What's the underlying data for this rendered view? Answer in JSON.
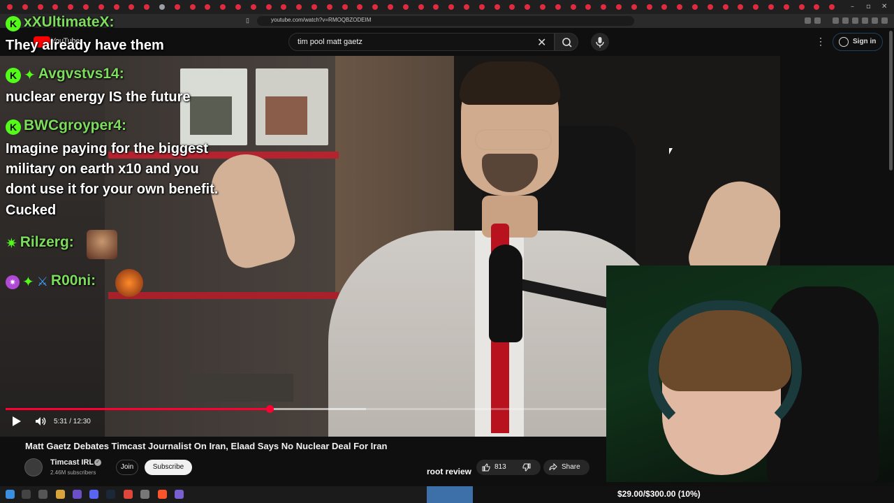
{
  "browser": {
    "url": "youtube.com/watch?v=RMOQBZODEIM"
  },
  "search": {
    "query": "tim pool matt gaetz"
  },
  "header": {
    "logo_text": "YouTube",
    "sign_in_label": "Sign in"
  },
  "player": {
    "time": "5:31 / 12:30",
    "progress_fraction": 0.44,
    "buffered_fraction": 0.6
  },
  "chat": {
    "messages": [
      {
        "user": "xXUltimateX:",
        "text": "They already have them"
      },
      {
        "user": "Avgvstvs14:",
        "text": "nuclear energy IS the future"
      },
      {
        "user": "BWCgroyper4:",
        "text_lines": [
          "Imagine paying for the biggest",
          "military on earth x10 and you",
          "dont use it for your own benefit.",
          "Cucked"
        ]
      },
      {
        "user": "Rilzerg:",
        "text": ""
      },
      {
        "user": "R00ni:",
        "text": ""
      }
    ]
  },
  "video": {
    "title": "Matt Gaetz Debates Timcast Journalist On Iran, Elaad Says No Nuclear Deal For Iran",
    "channel": "Timcast IRL",
    "subscribers": "2.46M subscribers",
    "join_label": "Join",
    "subscribe_label": "Subscribe",
    "likes": "813",
    "share_label": "Share"
  },
  "overlay": {
    "root_review": "root review",
    "donation_goal": "$29.00/$300.00 (10%)"
  },
  "colors": {
    "chat_username": "#7ddc5c",
    "kick_green": "#53fc18",
    "progress_red": "#ff0033",
    "shelf_red": "#b5232f"
  },
  "icons": [
    "search-icon",
    "clear-icon",
    "mic-icon",
    "more-icon",
    "account-icon",
    "play-icon",
    "volume-icon",
    "like-icon",
    "dislike-icon",
    "share-icon",
    "verified-icon"
  ]
}
